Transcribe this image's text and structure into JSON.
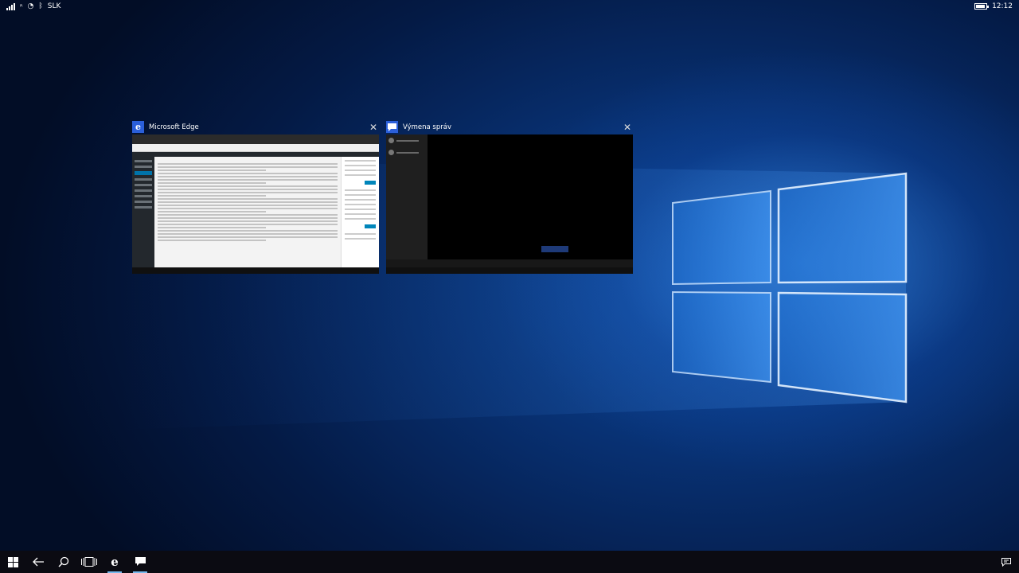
{
  "status_bar": {
    "network_label": "SLK",
    "time": "12:12",
    "icons": [
      "signal-icon",
      "roaming-icon",
      "wifi-icon",
      "bluetooth-icon",
      "battery-icon"
    ]
  },
  "task_view": {
    "windows": [
      {
        "app_name": "Microsoft Edge",
        "icon": "edge-icon",
        "icon_glyph": "e"
      },
      {
        "app_name": "Výmena správ",
        "icon": "messaging-icon"
      }
    ],
    "close_glyph": "✕"
  },
  "taskbar": {
    "buttons": [
      "start-icon",
      "back-icon",
      "search-icon",
      "task-view-icon",
      "edge-icon",
      "messaging-icon"
    ],
    "right_icons": [
      "action-center-icon"
    ]
  },
  "colors": {
    "accent": "#76b9ed",
    "edge_icon_bg": "#2b5fd9",
    "taskbar_bg": "#0b0b12"
  }
}
